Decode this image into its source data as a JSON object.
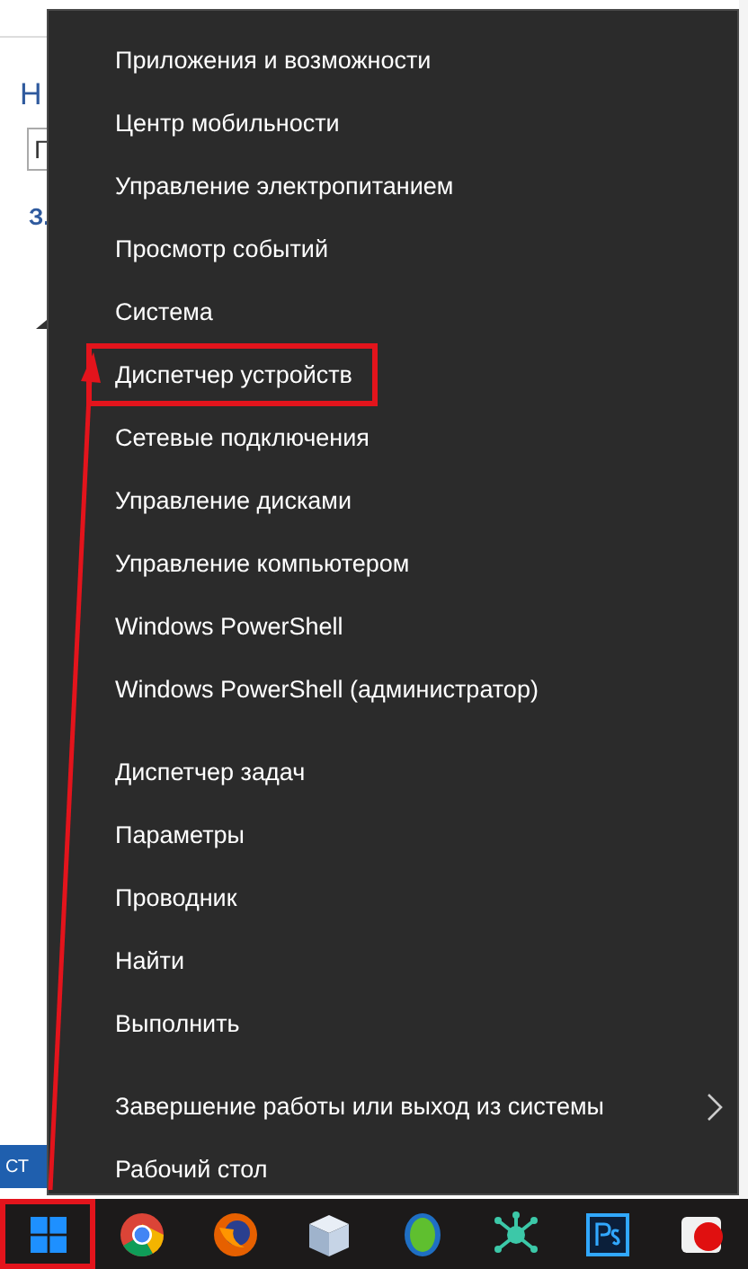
{
  "background_window": {
    "title": "Н",
    "field_value": "Г",
    "link": "З.",
    "status_text": "СТ"
  },
  "menu": {
    "sections": [
      {
        "items": [
          {
            "label": "Приложения и возможности",
            "highlighted": false,
            "has_submenu": false
          },
          {
            "label": "Центр мобильности",
            "highlighted": false,
            "has_submenu": false
          },
          {
            "label": "Управление электропитанием",
            "highlighted": false,
            "has_submenu": false
          },
          {
            "label": "Просмотр событий",
            "highlighted": false,
            "has_submenu": false
          },
          {
            "label": "Система",
            "highlighted": false,
            "has_submenu": false
          },
          {
            "label": "Диспетчер устройств",
            "highlighted": true,
            "has_submenu": false
          },
          {
            "label": "Сетевые подключения",
            "highlighted": false,
            "has_submenu": false
          },
          {
            "label": "Управление дисками",
            "highlighted": false,
            "has_submenu": false
          },
          {
            "label": "Управление компьютером",
            "highlighted": false,
            "has_submenu": false
          },
          {
            "label": "Windows PowerShell",
            "highlighted": false,
            "has_submenu": false
          },
          {
            "label": "Windows PowerShell (администратор)",
            "highlighted": false,
            "has_submenu": false
          }
        ]
      },
      {
        "items": [
          {
            "label": "Диспетчер задач",
            "highlighted": false,
            "has_submenu": false
          },
          {
            "label": "Параметры",
            "highlighted": false,
            "has_submenu": false
          },
          {
            "label": "Проводник",
            "highlighted": false,
            "has_submenu": false
          },
          {
            "label": "Найти",
            "highlighted": false,
            "has_submenu": false
          },
          {
            "label": "Выполнить",
            "highlighted": false,
            "has_submenu": false
          }
        ]
      },
      {
        "items": [
          {
            "label": "Завершение работы или выход из системы",
            "highlighted": false,
            "has_submenu": true
          },
          {
            "label": "Рабочий стол",
            "highlighted": false,
            "has_submenu": false
          }
        ]
      }
    ]
  },
  "taskbar": {
    "start_button": {
      "highlighted": true
    },
    "apps": [
      {
        "kind": "chrome"
      },
      {
        "kind": "firefox"
      },
      {
        "kind": "cube"
      },
      {
        "kind": "green-egg"
      },
      {
        "kind": "network"
      },
      {
        "kind": "photoshop"
      },
      {
        "kind": "red-app"
      }
    ]
  }
}
